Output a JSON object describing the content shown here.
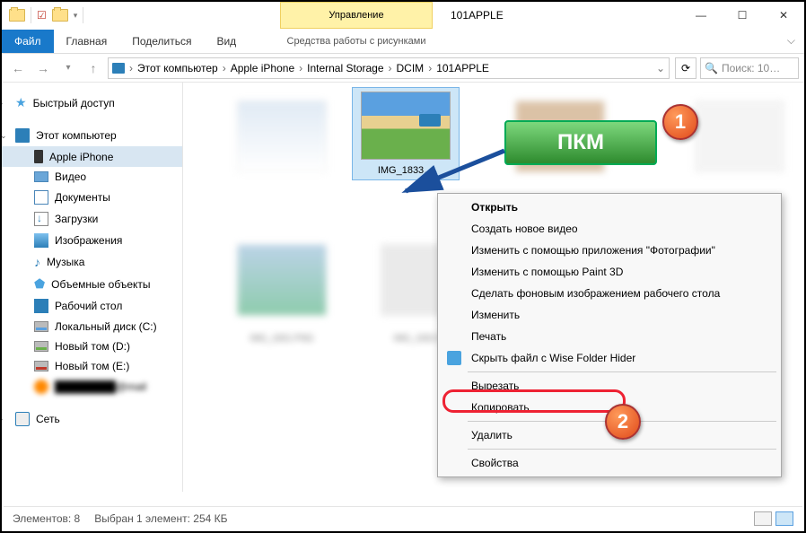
{
  "titlebar": {
    "manage_tab": "Управление",
    "window_title": "101APPLE"
  },
  "ribbon": {
    "file": "Файл",
    "home": "Главная",
    "share": "Поделиться",
    "view": "Вид",
    "sub_tools": "Средства работы с рисунками"
  },
  "breadcrumb": {
    "p0": "Этот компьютер",
    "p1": "Apple iPhone",
    "p2": "Internal Storage",
    "p3": "DCIM",
    "p4": "101APPLE"
  },
  "search": {
    "placeholder": "Поиск: 10…"
  },
  "sidebar": {
    "quick_access": "Быстрый доступ",
    "this_pc": "Этот компьютер",
    "iphone": "Apple iPhone",
    "video": "Видео",
    "documents": "Документы",
    "downloads": "Загрузки",
    "pictures": "Изображения",
    "music": "Музыка",
    "objects3d": "Объемные объекты",
    "desktop": "Рабочий стол",
    "disk_c": "Локальный диск (C:)",
    "disk_d": "Новый том (D:)",
    "disk_e": "Новый том (E:)",
    "mailru": "",
    "network": "Сеть"
  },
  "selected_file": {
    "name": "IMG_1833…"
  },
  "context_menu": {
    "open": "Открыть",
    "new_video": "Создать новое видео",
    "edit_photos": "Изменить с помощью приложения \"Фотографии\"",
    "edit_paint3d": "Изменить с помощью Paint 3D",
    "set_wallpaper": "Сделать фоновым изображением рабочего стола",
    "edit": "Изменить",
    "print": "Печать",
    "hide_wise": "Скрыть файл с Wise Folder Hider",
    "cut": "Вырезать",
    "copy": "Копировать",
    "delete": "Удалить",
    "properties": "Свойства"
  },
  "annotations": {
    "pkm": "ПКМ",
    "badge1": "1",
    "badge2": "2"
  },
  "status": {
    "items": "Элементов: 8",
    "selected": "Выбран 1 элемент: 254 КБ"
  }
}
